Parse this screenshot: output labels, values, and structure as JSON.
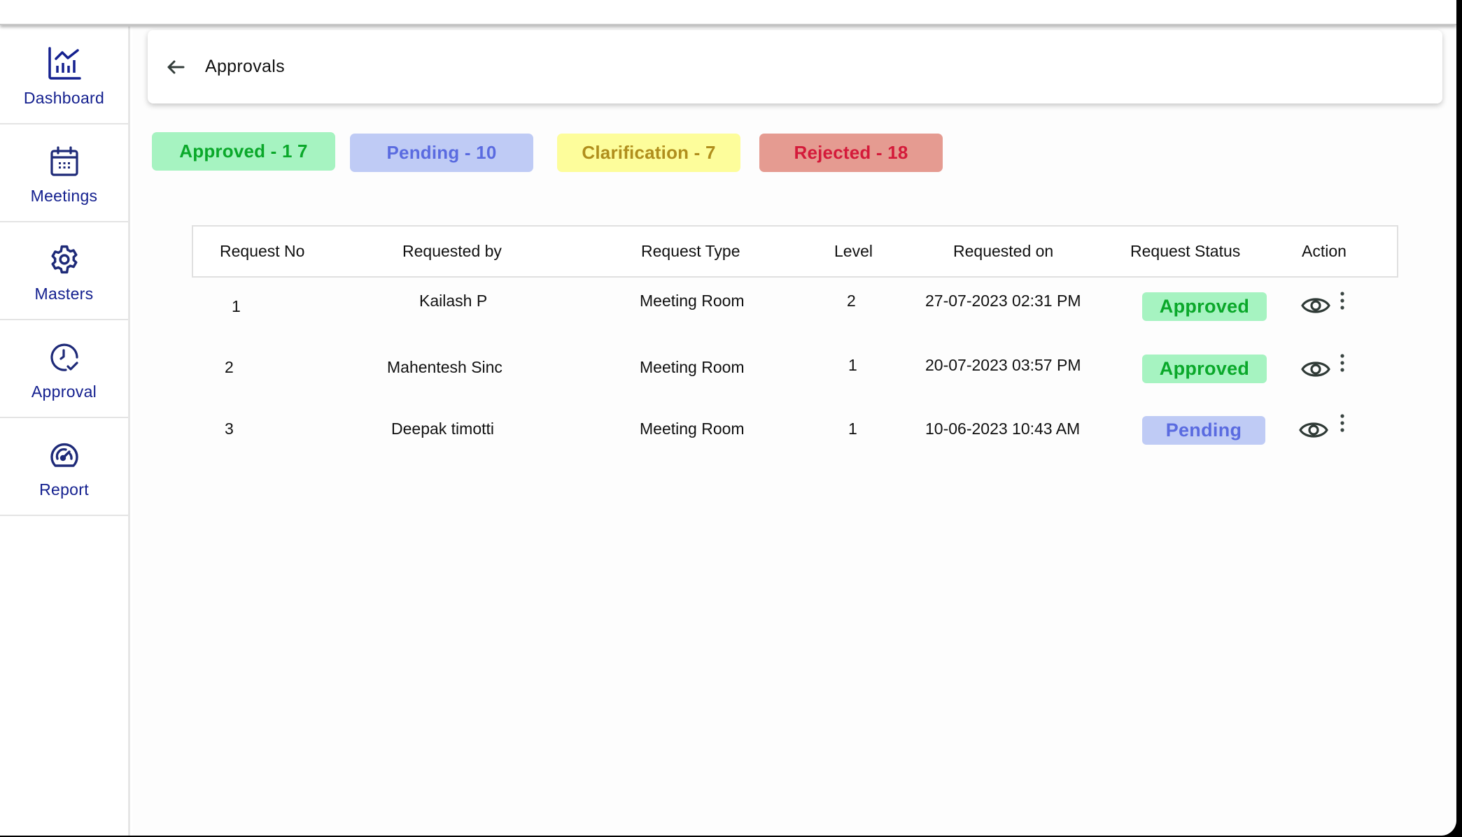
{
  "sidebar": {
    "items": [
      {
        "label": "Dashboard",
        "icon": "chart-line-icon"
      },
      {
        "label": "Meetings",
        "icon": "calendar-icon"
      },
      {
        "label": "Masters",
        "icon": "gear-icon"
      },
      {
        "label": "Approval",
        "icon": "clock-check-icon"
      },
      {
        "label": "Report",
        "icon": "speedometer-icon"
      }
    ],
    "color": "#14208f"
  },
  "header": {
    "title": "Approvals",
    "back_icon": "arrow-left-icon"
  },
  "summary": [
    {
      "label": "Approved - 1 7",
      "status": "approved",
      "bg": "#a6f3c1",
      "fg": "#0aa82a"
    },
    {
      "label": "Pending - 10",
      "status": "pending",
      "bg": "#bfcbf5",
      "fg": "#5a6be0"
    },
    {
      "label": "Clarification - 7",
      "status": "clarification",
      "bg": "#fdfd9b",
      "fg": "#b08e1c"
    },
    {
      "label": "Rejected - 18",
      "status": "rejected",
      "bg": "#e59b91",
      "fg": "#d41a3a"
    }
  ],
  "table": {
    "columns": [
      "Request No",
      "Requested by",
      "Request Type",
      "Level",
      "Requested on",
      "Request Status",
      "Action"
    ],
    "rows": [
      {
        "no": "1",
        "by": "Kailash P",
        "type": "Meeting Room",
        "level": "2",
        "on": "27-07-2023 02:31 PM",
        "status": "Approved"
      },
      {
        "no": "2",
        "by": "Mahentesh Sinc",
        "type": "Meeting Room",
        "level": "1",
        "on": "20-07-2023 03:57 PM",
        "status": "Approved"
      },
      {
        "no": "3",
        "by": "Deepak timotti",
        "type": "Meeting Room",
        "level": "1",
        "on": "10-06-2023 10:43 AM",
        "status": "Pending"
      }
    ],
    "action_icons": [
      "eye-icon",
      "more-vertical-icon"
    ]
  },
  "status_colors": {
    "Approved": {
      "bg": "#a6f3c1",
      "fg": "#0aa82a"
    },
    "Pending": {
      "bg": "#bfcbf5",
      "fg": "#5a6be0"
    }
  }
}
